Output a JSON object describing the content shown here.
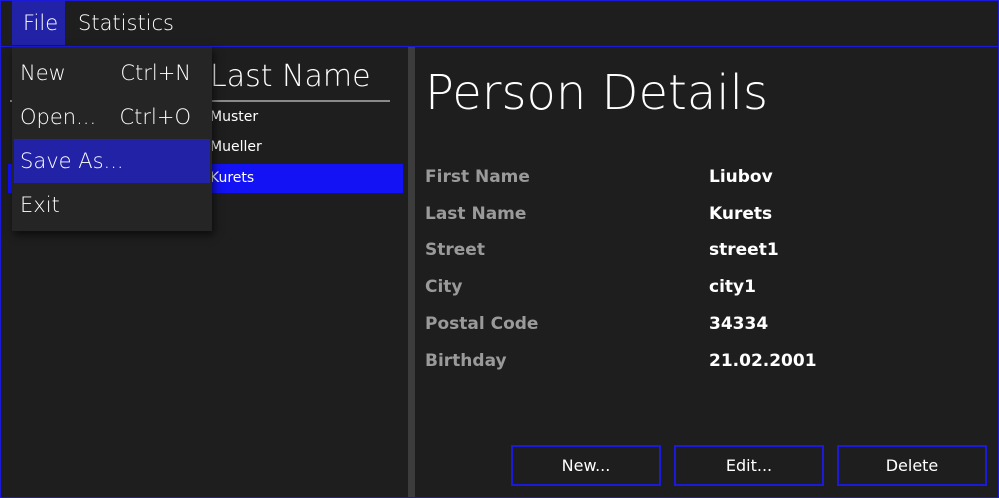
{
  "menubar": {
    "file_label": "File",
    "statistics_label": "Statistics"
  },
  "file_menu": {
    "items": [
      {
        "label": "New",
        "shortcut": "Ctrl+N"
      },
      {
        "label": "Open...",
        "shortcut": "Ctrl+O"
      },
      {
        "label": "Save As...",
        "shortcut": ""
      },
      {
        "label": "Exit",
        "shortcut": ""
      }
    ],
    "highlighted_index": 2
  },
  "person_list": {
    "column_header": "Last Name",
    "rows": [
      {
        "last_name": "Muster"
      },
      {
        "last_name": "Mueller"
      },
      {
        "last_name": "Kurets"
      }
    ],
    "selected_index": 2
  },
  "details": {
    "title": "Person Details",
    "fields": [
      {
        "label": "First Name",
        "value": "Liubov"
      },
      {
        "label": "Last Name",
        "value": "Kurets"
      },
      {
        "label": "Street",
        "value": "street1"
      },
      {
        "label": "City",
        "value": "city1"
      },
      {
        "label": "Postal Code",
        "value": "34334"
      },
      {
        "label": "Birthday",
        "value": "21.02.2001"
      }
    ]
  },
  "buttons": {
    "new_label": "New...",
    "edit_label": "Edit...",
    "delete_label": "Delete"
  },
  "colors": {
    "accent": "#1a1ad8",
    "selection": "#1212f5",
    "menu_highlight": "#2222a6",
    "background": "#1e1e1e",
    "label_gray": "#9a9a9a"
  }
}
